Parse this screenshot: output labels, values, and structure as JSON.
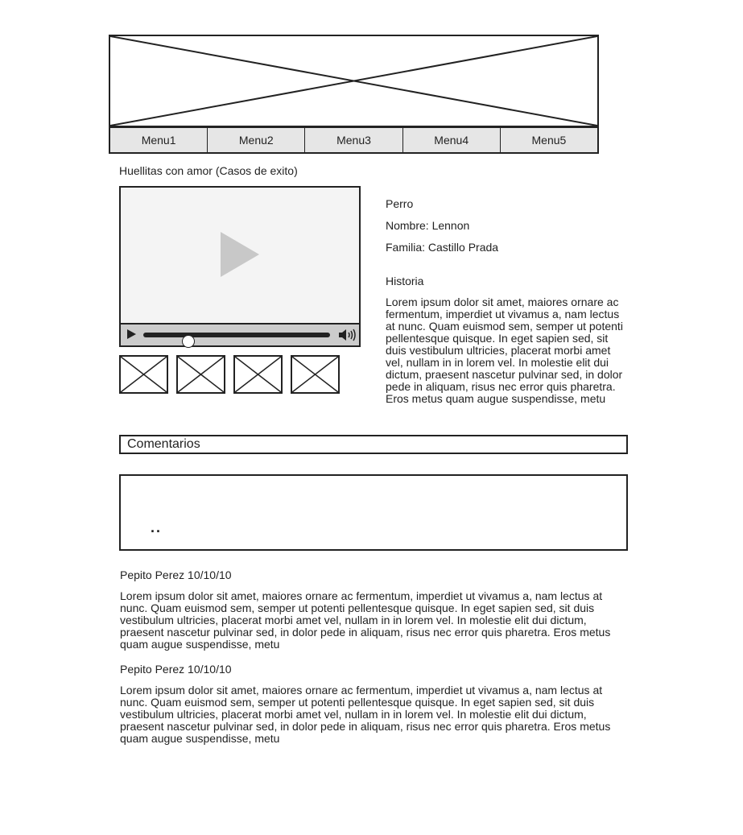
{
  "header": {
    "banner_image": "image-placeholder-icon"
  },
  "menu": {
    "items": [
      "Menu1",
      "Menu2",
      "Menu3",
      "Menu4",
      "Menu5"
    ]
  },
  "page_title": "Huellitas con amor (Casos de exito)",
  "video_player": {
    "progress": 0.24,
    "icons": [
      "play-icon",
      "volume-icon"
    ]
  },
  "pet": {
    "type": "Perro",
    "name_line": "Nombre: Lennon",
    "family_line": "Familia: Castillo Prada",
    "history_heading": "Historia",
    "history_text": "Lorem ipsum dolor sit amet, maiores ornare ac fermentum, imperdiet ut vivamus a, nam lectus at nunc. Quam euismod sem, semper ut potenti pellentesque quisque. In eget sapien sed, sit duis vestibulum ultricies, placerat morbi amet vel, nullam in in lorem vel. In molestie elit dui dictum, praesent nascetur pulvinar sed, in dolor pede in aliquam, risus nec error quis pharetra. Eros metus quam augue suspendisse, metu"
  },
  "comments": {
    "heading": "Comentarios",
    "input_value": "..",
    "items": [
      {
        "author": "Pepito Perez 10/10/10",
        "text": "Lorem ipsum dolor sit amet, maiores ornare ac fermentum, imperdiet ut vivamus a, nam lectus at nunc. Quam euismod sem, semper ut potenti pellentesque quisque. In eget sapien sed, sit duis vestibulum ultricies, placerat morbi amet vel, nullam in in lorem vel. In molestie elit dui dictum, praesent nascetur pulvinar sed, in dolor pede in aliquam, risus nec error quis pharetra. Eros metus quam augue suspendisse, metu"
      },
      {
        "author": "Pepito Perez 10/10/10",
        "text": "Lorem ipsum dolor sit amet, maiores ornare ac fermentum, imperdiet ut vivamus a, nam lectus at nunc. Quam euismod sem, semper ut potenti pellentesque quisque. In eget sapien sed, sit duis vestibulum ultricies, placerat morbi amet vel, nullam in in lorem vel. In molestie elit dui dictum, praesent nascetur pulvinar sed, in dolor pede in aliquam, risus nec error quis pharetra. Eros metus quam augue suspendisse, metu"
      }
    ]
  }
}
